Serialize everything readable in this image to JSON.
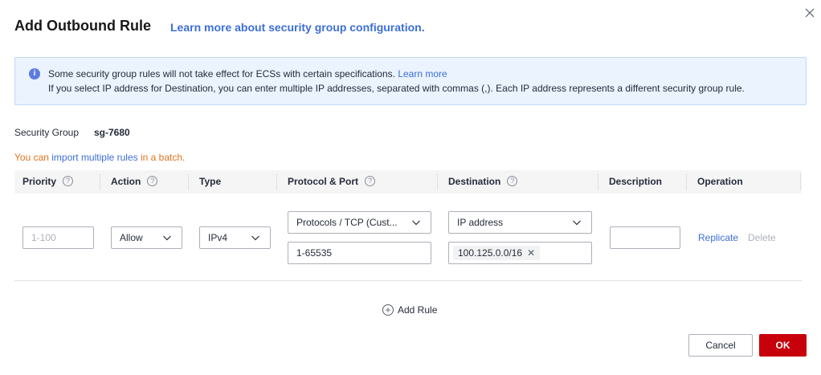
{
  "dialog": {
    "title": "Add Outbound Rule",
    "learn_link": "Learn more about security group configuration.",
    "close_icon": "close-icon"
  },
  "notice": {
    "icon": "info-icon",
    "line1": "Some security group rules will not take effect for ECSs with certain specifications.",
    "line1_link": "Learn more",
    "line2": "If you select IP address for Destination, you can enter multiple IP addresses, separated with commas (,). Each IP address represents a different security group rule."
  },
  "security_group": {
    "label": "Security Group",
    "value": "sg-7680"
  },
  "import_hint": {
    "prefix": "You can ",
    "link": "import multiple rules",
    "suffix": " in a batch."
  },
  "table": {
    "columns": [
      {
        "label": "Priority",
        "help": true
      },
      {
        "label": "Action",
        "help": true
      },
      {
        "label": "Type",
        "help": false
      },
      {
        "label": "Protocol & Port",
        "help": true
      },
      {
        "label": "Destination",
        "help": true
      },
      {
        "label": "Description",
        "help": false
      },
      {
        "label": "Operation",
        "help": false
      }
    ],
    "help_glyph": "?",
    "row": {
      "priority_placeholder": "1-100",
      "action": "Allow",
      "type": "IPv4",
      "protocol": "Protocols / TCP (Cust...",
      "port": "1-65535",
      "destination_type": "IP address",
      "destination_tag": "100.125.0.0/16",
      "description": "",
      "replicate": "Replicate",
      "delete": "Delete"
    }
  },
  "add_rule": "Add Rule",
  "footer": {
    "cancel": "Cancel",
    "ok": "OK"
  },
  "colors": {
    "link": "#3c6fd6",
    "primary_button": "#c7000b",
    "notice_bg": "#eaf3fe",
    "import_hint": "#e0741f"
  }
}
